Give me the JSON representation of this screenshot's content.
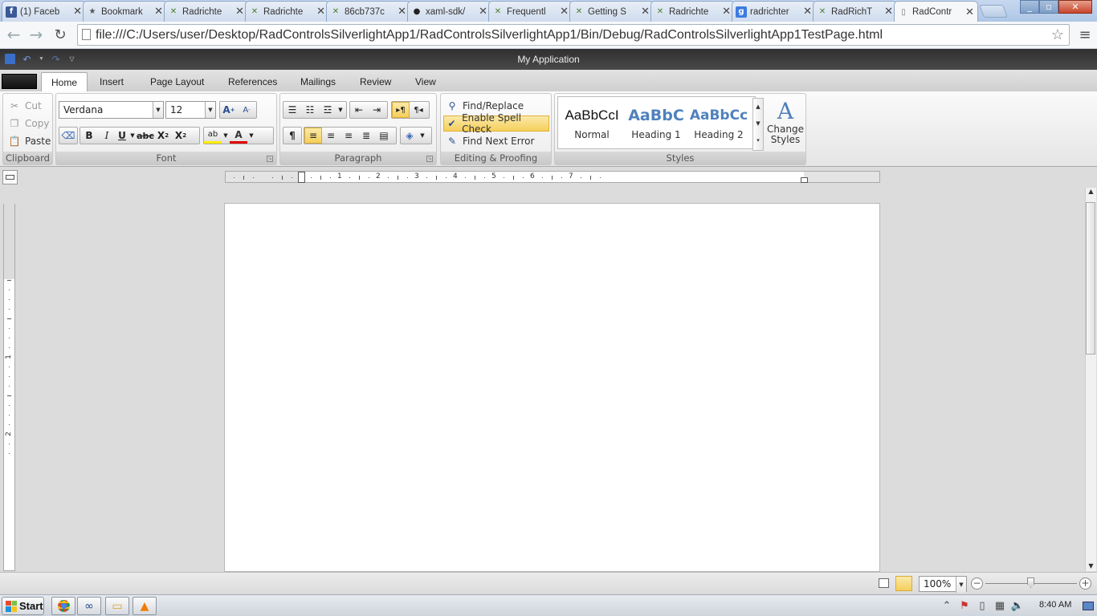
{
  "browser": {
    "tabs": [
      {
        "title": "(1) Faceb",
        "icon": "facebook-icon"
      },
      {
        "title": "Bookmark",
        "icon": "star-icon"
      },
      {
        "title": "Radrichte",
        "icon": "telerik-icon"
      },
      {
        "title": "Radrichte",
        "icon": "telerik-icon"
      },
      {
        "title": "86cb737c",
        "icon": "telerik-icon"
      },
      {
        "title": "xaml-sdk/",
        "icon": "github-icon"
      },
      {
        "title": "Frequentl",
        "icon": "telerik-icon"
      },
      {
        "title": "Getting S",
        "icon": "telerik-icon"
      },
      {
        "title": "Radrichte",
        "icon": "telerik-icon"
      },
      {
        "title": "radrichter",
        "icon": "google-icon"
      },
      {
        "title": "RadRichT",
        "icon": "telerik-icon"
      },
      {
        "title": "RadContr",
        "icon": "page-icon"
      }
    ],
    "active_tab_index": 11,
    "url": "file:///C:/Users/user/Desktop/RadControlsSilverlightApp1/RadControlsSilverlightApp1/Bin/Debug/RadControlsSilverlightApp1TestPage.html"
  },
  "app": {
    "title": "My Application"
  },
  "ribbon_tabs": [
    "Home",
    "Insert",
    "Page Layout",
    "References",
    "Mailings",
    "Review",
    "View"
  ],
  "active_ribbon_tab": "Home",
  "clipboard": {
    "cut": "Cut",
    "copy": "Copy",
    "paste": "Paste",
    "caption": "Clipboard"
  },
  "font": {
    "family": "Verdana",
    "size": "12",
    "caption": "Font"
  },
  "paragraph": {
    "caption": "Paragraph"
  },
  "editing": {
    "find_replace": "Find/Replace",
    "spell_check": "Enable Spell Check",
    "find_next_error": "Find Next Error",
    "caption": "Editing & Proofing"
  },
  "styles": {
    "items": [
      {
        "preview": "AaBbCcI",
        "name": "Normal"
      },
      {
        "preview": "AaBbC",
        "name": "Heading 1"
      },
      {
        "preview": "AaBbCc",
        "name": "Heading 2"
      }
    ],
    "change_styles_line1": "Change",
    "change_styles_line2": "Styles",
    "caption": "Styles"
  },
  "ruler": {
    "numbers": [
      "1",
      "2",
      "3",
      "4",
      "5",
      "6",
      "7"
    ],
    "v_numbers": [
      "1",
      "2",
      "3"
    ]
  },
  "status": {
    "zoom": "100%"
  },
  "taskbar": {
    "start": "Start",
    "clock": "8:40 AM"
  },
  "colors": {
    "accent_highlight": "#f5cf5a",
    "heading_blue": "#4f81bd",
    "title_bar": "#3a3a3a"
  }
}
